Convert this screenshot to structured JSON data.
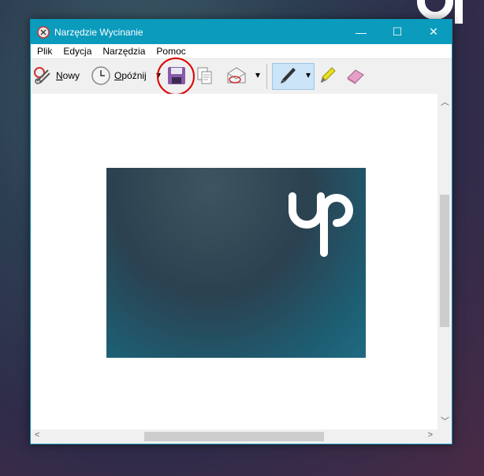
{
  "window": {
    "title": "Narzędzie Wycinanie",
    "controls": {
      "minimize": "—",
      "maximize": "☐",
      "close": "✕"
    }
  },
  "menu": [
    "Plik",
    "Edycja",
    "Narzędzia",
    "Pomoc"
  ],
  "toolbar": {
    "new_label": "Nowy",
    "delay_label": "Opóźnij",
    "dropdown_glyph": "▾"
  },
  "colors": {
    "titlebar": "#0a9bbd",
    "highlight_circle": "#e00000",
    "active_tool": "#cce4f7"
  },
  "icons": [
    "snip-scissors-icon",
    "clock-icon",
    "save-icon",
    "copy-icon",
    "send-email-icon",
    "pen-icon",
    "highlighter-icon",
    "eraser-icon"
  ]
}
